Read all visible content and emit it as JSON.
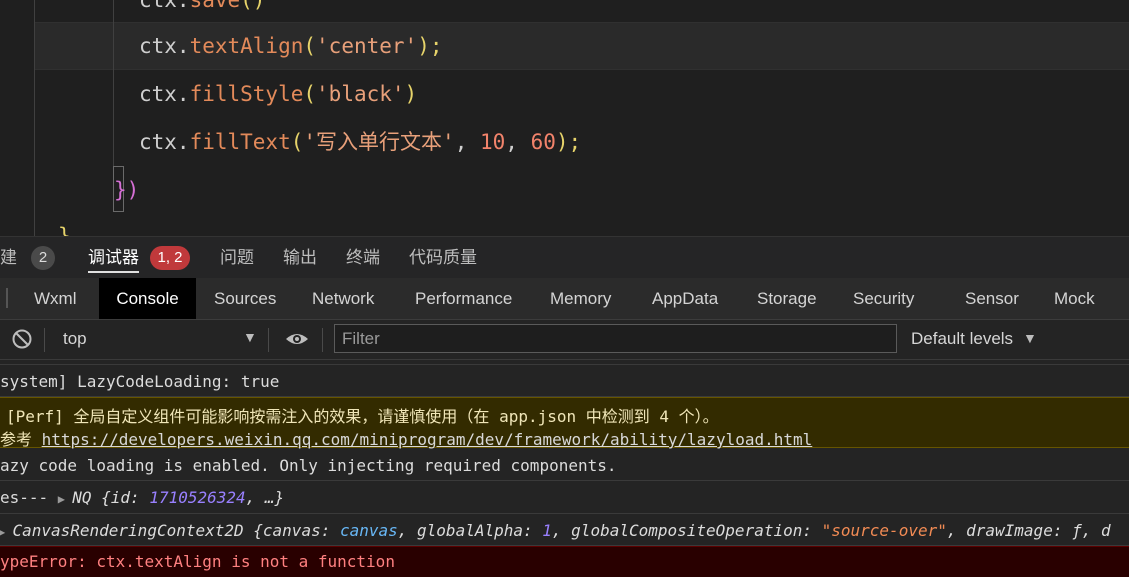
{
  "editor": {
    "lines": {
      "l0": {
        "obj": "ctx.",
        "fn": "save",
        "rest": "()"
      },
      "l1": {
        "obj": "ctx.",
        "fn": "textAlign",
        "open": "(",
        "str": "'center'",
        "close": ");"
      },
      "l2": {
        "obj": "ctx.",
        "fn": "fillStyle",
        "open": "(",
        "str": "'black'",
        "close": ")"
      },
      "l3": {
        "obj": "ctx.",
        "fn": "fillText",
        "open": "(",
        "str": "'写入单行文本'",
        "sep1": ", ",
        "n1": "10",
        "sep2": ", ",
        "n2": "60",
        "close": ");"
      },
      "l4": {
        "brace": "}",
        "paren": ")"
      },
      "l5": {
        "text": "}"
      }
    }
  },
  "panel_tabs": [
    {
      "label": "建",
      "badge": "2"
    },
    {
      "label": "调试器",
      "badge": "1, 2"
    },
    {
      "label": "问题"
    },
    {
      "label": "输出"
    },
    {
      "label": "终端"
    },
    {
      "label": "代码质量"
    }
  ],
  "devtools_tabs": [
    "Wxml",
    "Console",
    "Sources",
    "Network",
    "Performance",
    "Memory",
    "AppData",
    "Storage",
    "Security",
    "Sensor",
    "Mock"
  ],
  "toolbar": {
    "context": "top",
    "filter_placeholder": "Filter",
    "levels": "Default levels"
  },
  "console": {
    "r0": "system] LazyCodeLoading: true",
    "r1a": "[Perf] 全局自定义组件可能影响按需注入的效果，请谨慎使用（在 app.json 中检测到 4 个）。",
    "r1b_prefix": "参考 ",
    "r1b_link": "https://developers.weixin.qq.com/miniprogram/dev/framework/ability/lazyload.html",
    "r2": "azy code loading is enabled. Only injecting required components.",
    "r3_prefix": "es--- ",
    "r3_obj": "NQ {id: ",
    "r3_id": "1710526324",
    "r3_end": ", …}",
    "r4_head": "CanvasRenderingContext2D {canvas: ",
    "r4_canvas": "canvas",
    "r4_ga": ", globalAlpha: ",
    "r4_ga_val": "1",
    "r4_gco": ", globalCompositeOperation: ",
    "r4_gco_val": "\"source-over\"",
    "r4_tail": ", drawImage: ƒ, d",
    "r5": "ypeError: ctx.textAlign is not a function"
  }
}
